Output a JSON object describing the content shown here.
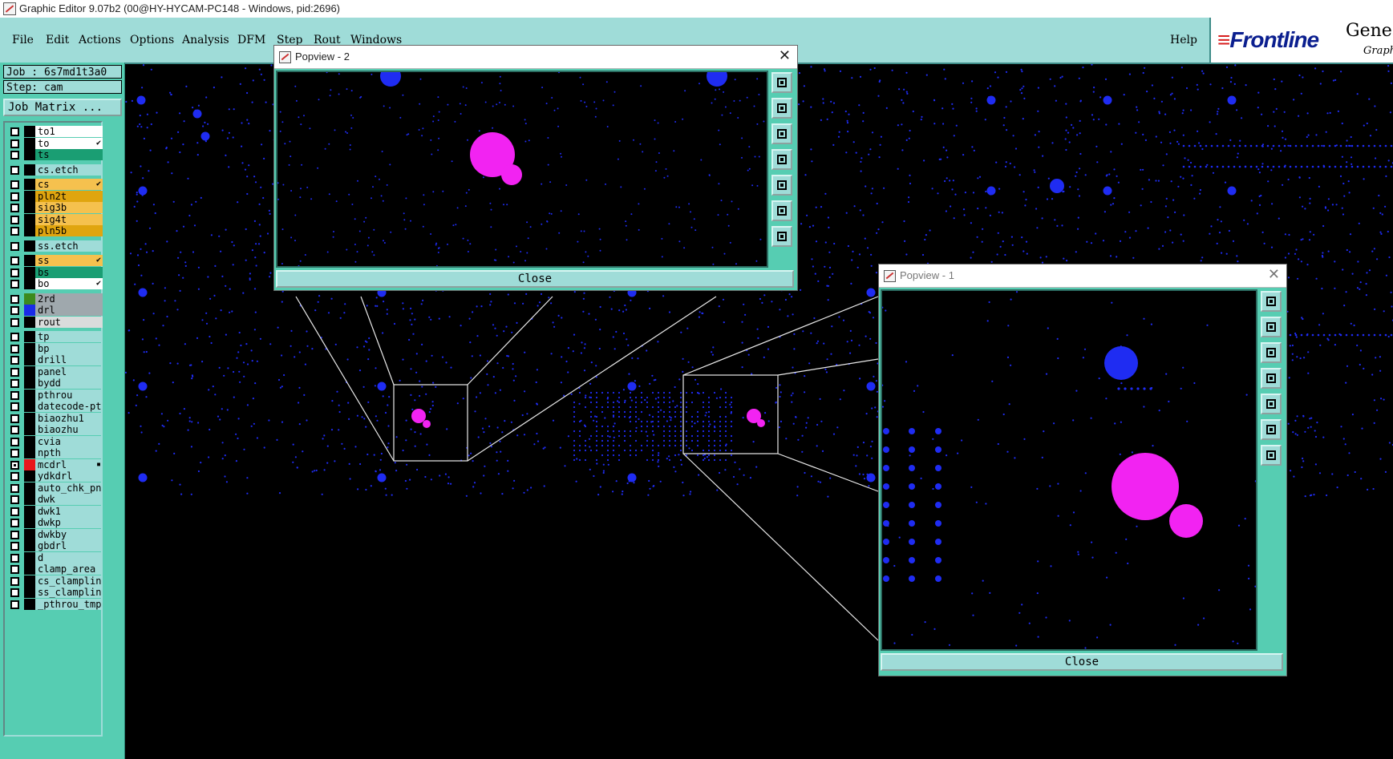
{
  "window": {
    "title": "Graphic Editor 9.07b2 (00@HY-HYCAM-PC148 - Windows, pid:2696)"
  },
  "menu": {
    "items": [
      "File",
      "Edit",
      "Actions",
      "Options",
      "Analysis",
      "DFM",
      "Step",
      "Rout",
      "Windows"
    ],
    "help": "Help"
  },
  "brand": {
    "logo": "Frontline",
    "product": "Genes",
    "subtitle": "Graph"
  },
  "job": {
    "job_line": "Job : 6s7md1t3a0",
    "step_line": "Step: cam",
    "matrix_button": "Job Matrix ..."
  },
  "layers": [
    {
      "name": "to1",
      "color": "#ffffff",
      "mark": ""
    },
    {
      "name": "to",
      "color": "#ffffff",
      "mark": "✔"
    },
    {
      "name": "ts",
      "color": "#1a9e73",
      "mark": ""
    },
    {
      "name": "cs.etch",
      "color": "#9fdcd8",
      "mark": ""
    },
    {
      "name": "cs",
      "color": "#f5c14e",
      "mark": "✔"
    },
    {
      "name": "pln2t",
      "color": "#e0a50f",
      "mark": ""
    },
    {
      "name": "sig3b",
      "color": "#f5c14e",
      "mark": ""
    },
    {
      "name": "sig4t",
      "color": "#f5c14e",
      "mark": ""
    },
    {
      "name": "pln5b",
      "color": "#e0a50f",
      "mark": ""
    },
    {
      "name": "ss.etch",
      "color": "#9fdcd8",
      "mark": ""
    },
    {
      "name": "ss",
      "color": "#f5c14e",
      "mark": "✔"
    },
    {
      "name": "bs",
      "color": "#1a9e73",
      "mark": ""
    },
    {
      "name": "bo",
      "color": "#ffffff",
      "mark": "✔"
    },
    {
      "name": "2rd",
      "color": "#9fa8ad",
      "mark": "",
      "swatch": "#3c8a1e"
    },
    {
      "name": "drl",
      "color": "#9fa8ad",
      "mark": "",
      "swatch": "#1a2be8"
    },
    {
      "name": "rout",
      "color": "#d9dcdc",
      "mark": ""
    },
    {
      "name": "tp",
      "color": "#9fdcd8",
      "mark": ""
    },
    {
      "name": "bp",
      "color": "#9fdcd8",
      "mark": ""
    },
    {
      "name": "drill",
      "color": "#9fdcd8",
      "mark": ""
    },
    {
      "name": "panel",
      "color": "#9fdcd8",
      "mark": ""
    },
    {
      "name": "bydd",
      "color": "#9fdcd8",
      "mark": ""
    },
    {
      "name": "pthrou",
      "color": "#9fdcd8",
      "mark": ""
    },
    {
      "name": "datecode-pt",
      "color": "#9fdcd8",
      "mark": ""
    },
    {
      "name": "biaozhu1",
      "color": "#9fdcd8",
      "mark": ""
    },
    {
      "name": "biaozhu",
      "color": "#9fdcd8",
      "mark": ""
    },
    {
      "name": "cvia",
      "color": "#9fdcd8",
      "mark": ""
    },
    {
      "name": "npth",
      "color": "#9fdcd8",
      "mark": ""
    },
    {
      "name": "mcdrl",
      "color": "#9fdcd8",
      "mark": "▪",
      "swatch": "#e8161b",
      "active": true
    },
    {
      "name": "ydkdrl",
      "color": "#9fdcd8",
      "mark": ""
    },
    {
      "name": "auto_chk_pn",
      "color": "#9fdcd8",
      "mark": ""
    },
    {
      "name": "dwk",
      "color": "#9fdcd8",
      "mark": ""
    },
    {
      "name": "dwk1",
      "color": "#9fdcd8",
      "mark": ""
    },
    {
      "name": "dwkp",
      "color": "#9fdcd8",
      "mark": ""
    },
    {
      "name": "dwkby",
      "color": "#9fdcd8",
      "mark": ""
    },
    {
      "name": "gbdrl",
      "color": "#9fdcd8",
      "mark": ""
    },
    {
      "name": "d",
      "color": "#9fdcd8",
      "mark": ""
    },
    {
      "name": "clamp_area",
      "color": "#9fdcd8",
      "mark": ""
    },
    {
      "name": "cs_clamplin",
      "color": "#9fdcd8",
      "mark": ""
    },
    {
      "name": "ss_clamplin",
      "color": "#9fdcd8",
      "mark": ""
    },
    {
      "name": "_pthrou_tmp",
      "color": "#9fdcd8",
      "mark": ""
    }
  ],
  "popview2": {
    "title": "Popview - 2",
    "close_label": "Close"
  },
  "popview1": {
    "title": "Popview - 1",
    "close_label": "Close"
  },
  "colors": {
    "pad_blue": "#1f2cf2",
    "highlight_magenta": "#f223f2",
    "panel_teal": "#56cdb2",
    "light_teal": "#9fdcd8"
  },
  "icons": [
    "zoom-fit-icon",
    "pan-up-icon",
    "pan-down-icon",
    "pan-left-icon",
    "pan-right-icon",
    "zoom-out-icon",
    "zoom-in-icon"
  ]
}
